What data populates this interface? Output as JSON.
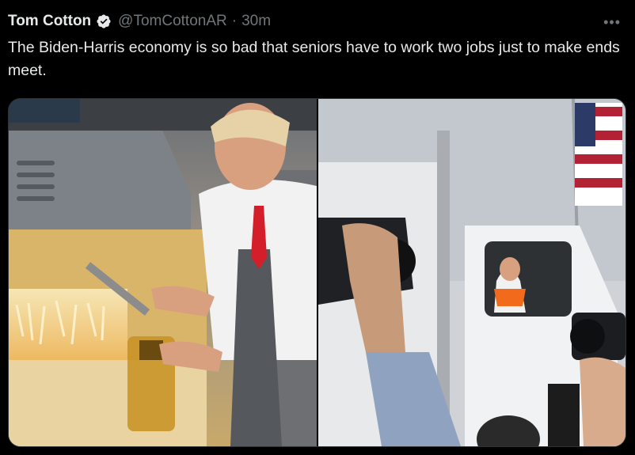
{
  "tweet": {
    "author_name": "Tom Cotton",
    "handle": "@TomCottonAR",
    "separator": "·",
    "time": "30m",
    "text": "The Biden-Harris economy is so bad that seniors have to work two jobs just to make ends meet.",
    "more_icon": "more-horizontal-icon"
  },
  "media": {
    "left_photo": "fast-food-fryer-station-photo",
    "right_photo": "garbage-truck-cab-photo"
  },
  "colors": {
    "background": "#000000",
    "text_primary": "#e7e9ea",
    "text_secondary": "#71767b",
    "verified_badge": "#e7e9ea"
  }
}
